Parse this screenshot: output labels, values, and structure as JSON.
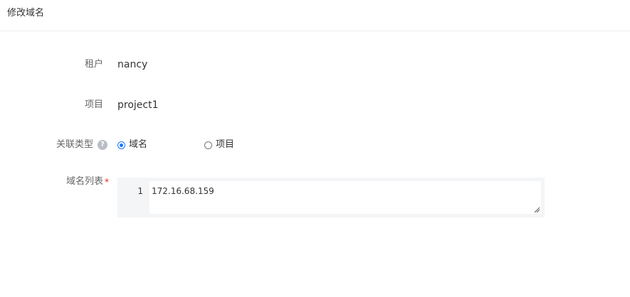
{
  "header": {
    "title": "修改域名"
  },
  "form": {
    "tenant": {
      "label": "租户",
      "value": "nancy"
    },
    "project": {
      "label": "项目",
      "value": "project1"
    },
    "association_type": {
      "label": "关联类型",
      "help_icon": "question-circle-icon",
      "help_glyph": "?",
      "options": [
        {
          "label": "域名",
          "selected": true
        },
        {
          "label": "项目",
          "selected": false
        }
      ]
    },
    "domain_list": {
      "label": "域名列表",
      "required_mark": "*",
      "line_numbers": [
        "1"
      ],
      "lines": [
        "172.16.68.159"
      ]
    }
  },
  "colors": {
    "accent": "#1677ff",
    "required": "#e02020",
    "editor_bg": "#f4f5f7",
    "label_text": "#666666"
  }
}
